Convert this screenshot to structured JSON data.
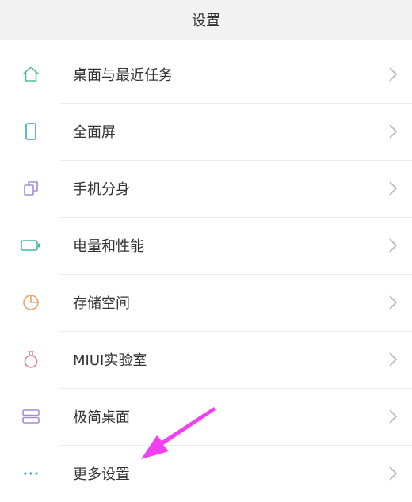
{
  "header": {
    "title": "设置"
  },
  "settings": {
    "items": [
      {
        "label": "桌面与最近任务",
        "icon": "home-icon",
        "color": "#4cbf9a"
      },
      {
        "label": "全面屏",
        "icon": "phone-icon",
        "color": "#36a6c8"
      },
      {
        "label": "手机分身",
        "icon": "dual-app-icon",
        "color": "#a68bd6"
      },
      {
        "label": "电量和性能",
        "icon": "battery-icon",
        "color": "#3fb8a6"
      },
      {
        "label": "存储空间",
        "icon": "storage-pie-icon",
        "color": "#f0a368"
      },
      {
        "label": "MIUI实验室",
        "icon": "lab-flask-icon",
        "color": "#e2809a"
      },
      {
        "label": "极简桌面",
        "icon": "simple-launcher-icon",
        "color": "#a68bd6"
      },
      {
        "label": "更多设置",
        "icon": "more-dots-icon",
        "color": "#4aa8c8"
      }
    ]
  },
  "annotation": {
    "arrow_color": "#f040f0"
  }
}
